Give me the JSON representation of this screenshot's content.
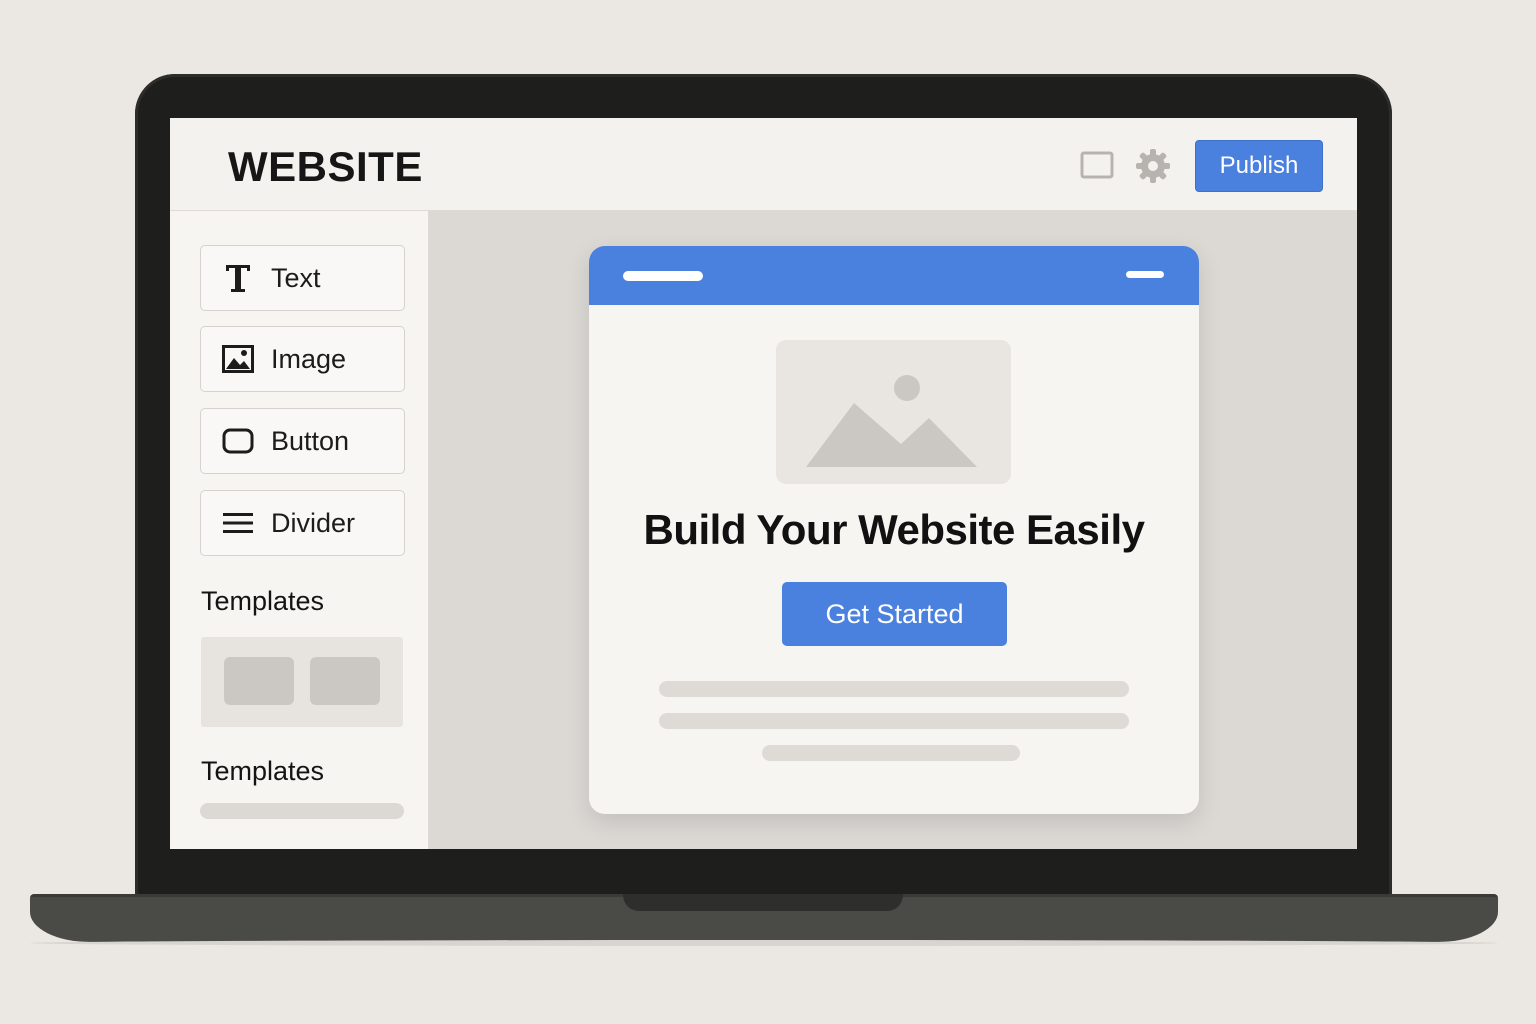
{
  "topbar": {
    "brand": "WEBSITE",
    "publish_label": "Publish",
    "icons": [
      "device-preview-icon",
      "gear-icon"
    ]
  },
  "sidebar": {
    "tools": [
      {
        "label": "Text",
        "icon": "text-icon"
      },
      {
        "label": "Image",
        "icon": "image-icon"
      },
      {
        "label": "Button",
        "icon": "button-icon"
      },
      {
        "label": "Divider",
        "icon": "divider-icon"
      }
    ],
    "sections": [
      "Templates",
      "Templates"
    ]
  },
  "preview": {
    "headline": "Build Your Website Easily",
    "cta_label": "Get Started",
    "image_icon": "image-placeholder-icon"
  },
  "colors": {
    "accent": "#4a80de",
    "background": "#ebe7e3",
    "panel": "#f7f5f2",
    "canvas": "#dcd9d5",
    "text": "#111111"
  }
}
